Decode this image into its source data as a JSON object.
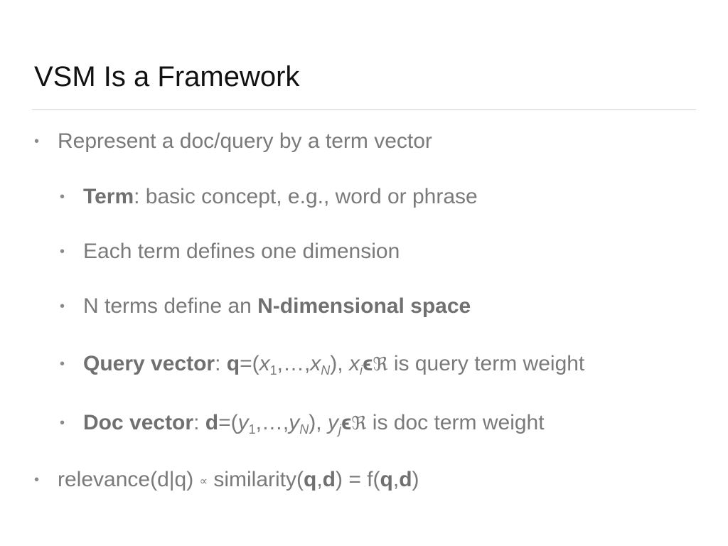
{
  "slide": {
    "title": "VSM Is a Framework",
    "bullets": {
      "b1": "Represent a doc/query by a term vector",
      "b1_1_bold": "Term",
      "b1_1_rest": ": basic concept, e.g., word or phrase",
      "b1_2": "Each term defines one dimension",
      "b1_3_pre": "N terms define an ",
      "b1_3_bold": "N-dimensional space",
      "query": {
        "label": "Query vector",
        "colon": ": ",
        "vec": "q",
        "eq_open": "=(",
        "x": "x",
        "sub1": "1",
        "dots": ",…,",
        "subN": "N",
        "close": "), ",
        "xi": "x",
        "subi": "i",
        "in": "ϵ",
        "real": "ℜ",
        "rest": " is query term weight"
      },
      "doc": {
        "label": "Doc vector",
        "colon": ": ",
        "vec": "d",
        "eq_open": "=(",
        "y": "y",
        "sub1": "1",
        "dots": ",…,",
        "subN": "N",
        "close": "), ",
        "yj": "y",
        "subj": "j",
        "in": "ϵ",
        "real": "ℜ",
        "rest": " is doc term weight"
      },
      "relevance": {
        "pre": "relevance(d|q) ",
        "prop": "∝",
        "mid": " similarity(",
        "q": "q",
        "comma": ",",
        "d": "d",
        "mid2": ") = f(",
        "end": ")"
      }
    }
  }
}
